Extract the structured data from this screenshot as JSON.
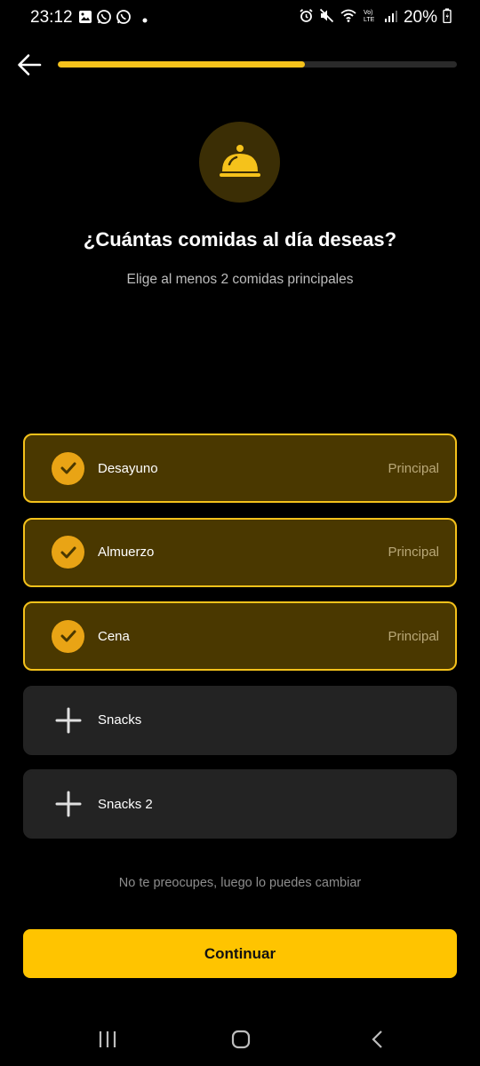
{
  "status_bar": {
    "time": "23:12",
    "battery": "20%",
    "left_icons": [
      "gallery-icon",
      "whatsapp-icon",
      "whatsapp-icon",
      "dot-icon"
    ],
    "right_icons": [
      "alarm-icon",
      "mute-icon",
      "wifi-icon",
      "volte-icon",
      "signal-icon",
      "battery-icon"
    ]
  },
  "header": {
    "progress": 0.62,
    "accent_color": "#f5c21b"
  },
  "hero_icon": "food-cloche-icon",
  "title": "¿Cuántas comidas al día deseas?",
  "subtitle": "Elige al menos 2 comidas principales",
  "meals": [
    {
      "label": "Desayuno",
      "tag": "Principal",
      "selected": true
    },
    {
      "label": "Almuerzo",
      "tag": "Principal",
      "selected": true
    },
    {
      "label": "Cena",
      "tag": "Principal",
      "selected": true
    },
    {
      "label": "Snacks",
      "tag": "",
      "selected": false
    },
    {
      "label": "Snacks 2",
      "tag": "",
      "selected": false
    }
  ],
  "note": "No te preocupes, luego lo puedes cambiar",
  "continue_label": "Continuar",
  "nav": [
    "recents-icon",
    "home-icon",
    "back-icon"
  ]
}
